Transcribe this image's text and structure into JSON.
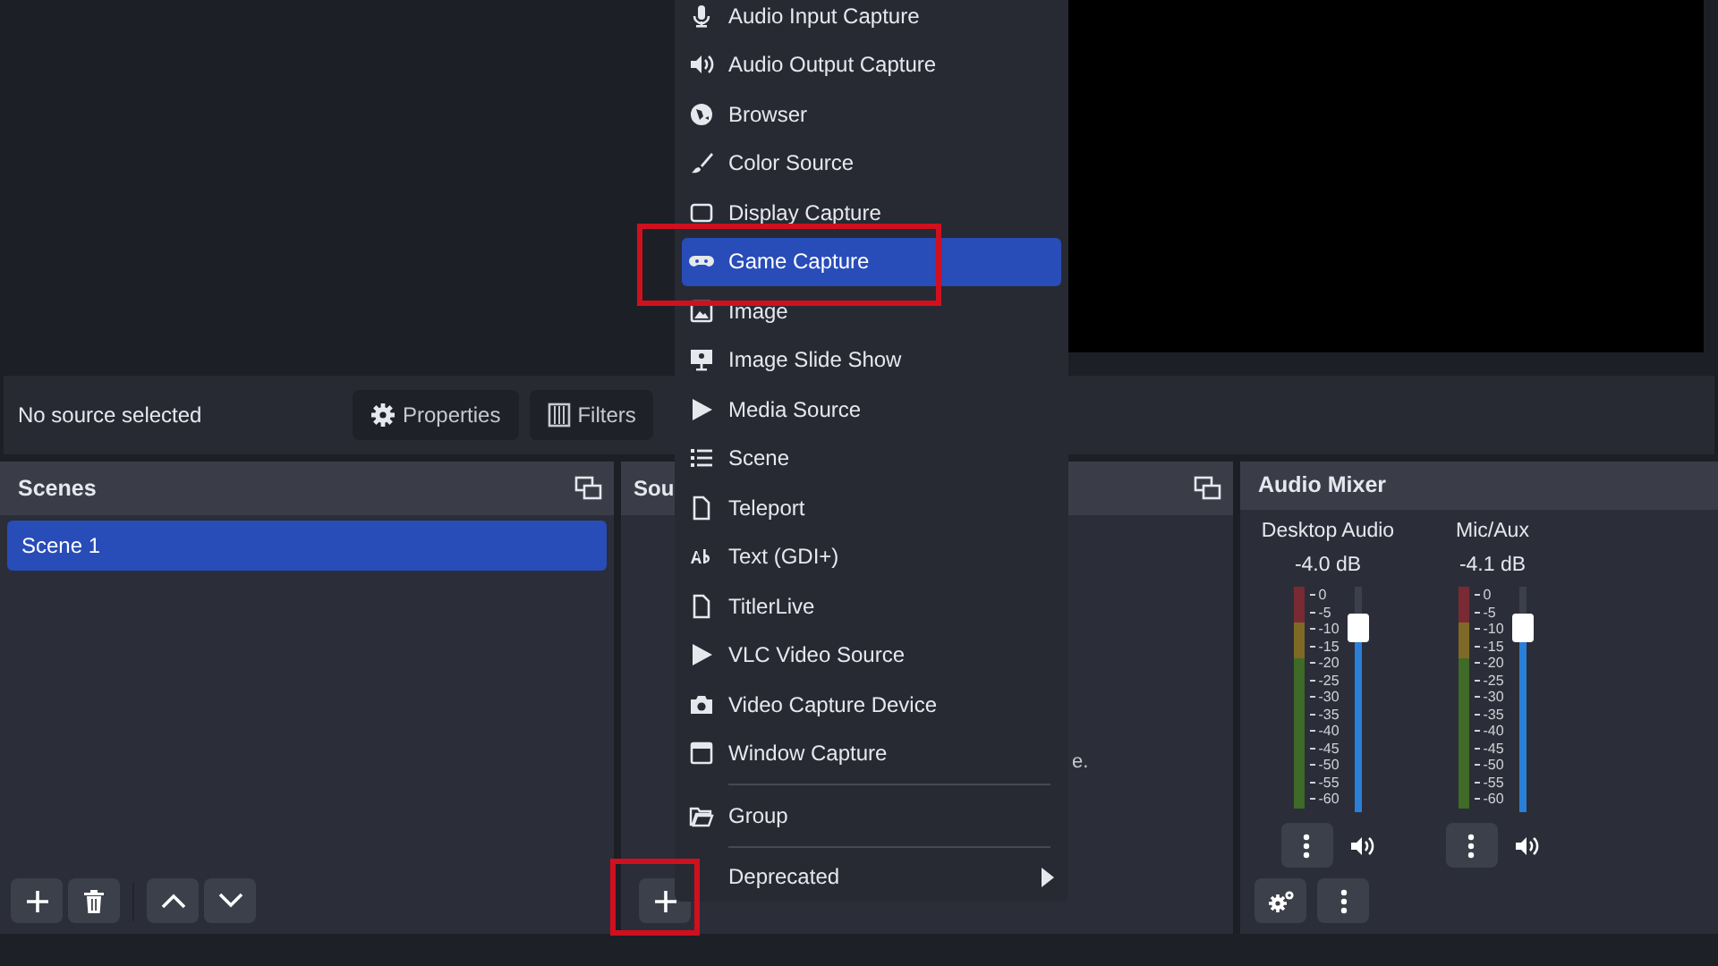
{
  "source_bar": {
    "status": "No source selected",
    "buttons": [
      "Properties",
      "Filters"
    ]
  },
  "scenes": {
    "title": "Scenes",
    "items": [
      {
        "label": "Scene 1",
        "selected": true
      }
    ]
  },
  "sources": {
    "title": "Sou",
    "hint_fragment": "e."
  },
  "audio_mixer": {
    "title": "Audio Mixer",
    "channels": [
      {
        "name": "Desktop Audio",
        "reading": "-4.0 dB",
        "level": 0.82,
        "scale": [
          "0",
          "-5",
          "-10",
          "-15",
          "-20",
          "-25",
          "-30",
          "-35",
          "-40",
          "-45",
          "-50",
          "-55",
          "-60"
        ]
      },
      {
        "name": "Mic/Aux",
        "reading": "-4.1 dB",
        "level": 0.82,
        "scale": [
          "0",
          "-5",
          "-10",
          "-15",
          "-20",
          "-25",
          "-30",
          "-35",
          "-40",
          "-45",
          "-50",
          "-55",
          "-60"
        ]
      }
    ]
  },
  "add_source_menu": {
    "items": [
      {
        "label": "Audio Input Capture",
        "selected": false
      },
      {
        "label": "Audio Output Capture",
        "selected": false
      },
      {
        "label": "Browser",
        "selected": false
      },
      {
        "label": "Color Source",
        "selected": false
      },
      {
        "label": "Display Capture",
        "selected": false
      },
      {
        "label": "Game Capture",
        "selected": true
      },
      {
        "label": "Image",
        "selected": false
      },
      {
        "label": "Image Slide Show",
        "selected": false
      },
      {
        "label": "Media Source",
        "selected": false
      },
      {
        "label": "Scene",
        "selected": false
      },
      {
        "label": "Teleport",
        "selected": false
      },
      {
        "label": "Text (GDI+)",
        "selected": false
      },
      {
        "label": "TitlerLive",
        "selected": false
      },
      {
        "label": "VLC Video Source",
        "selected": false
      },
      {
        "label": "Video Capture Device",
        "selected": false
      },
      {
        "label": "Window Capture",
        "selected": false
      }
    ],
    "group": {
      "label": "Group"
    },
    "submenu": {
      "label": "Deprecated"
    }
  }
}
